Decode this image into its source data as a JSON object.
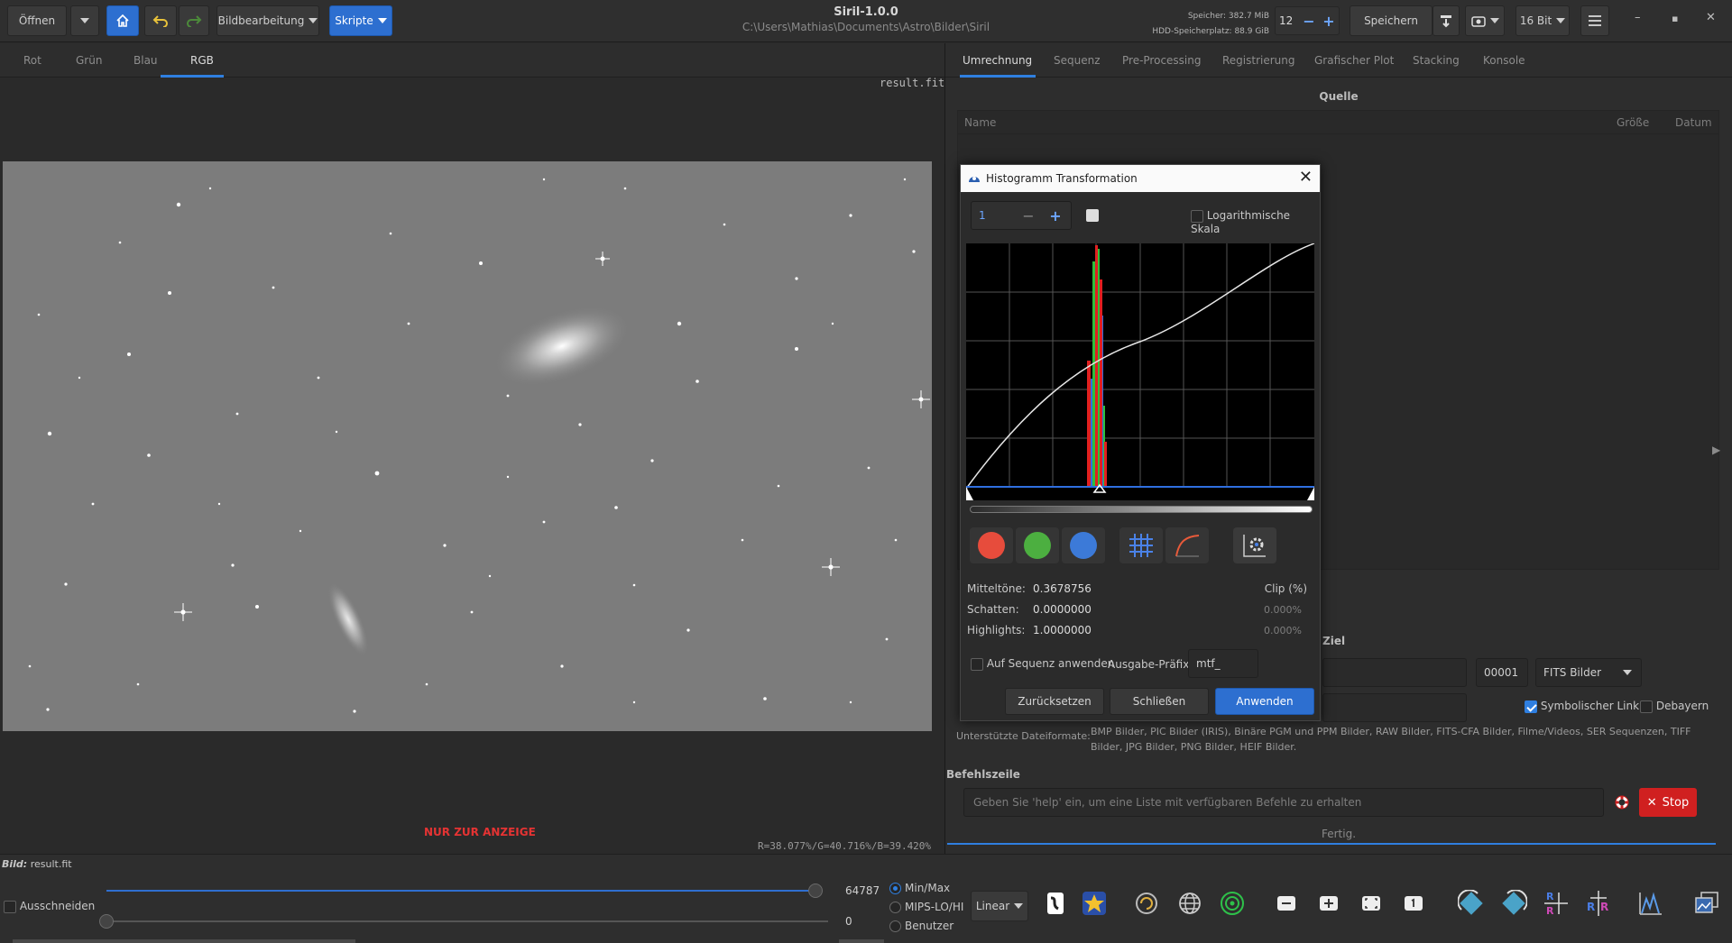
{
  "header": {
    "open": "Öffnen",
    "image_processing": "Bildbearbeitung",
    "scripts": "Skripte",
    "title": "Siril-1.0.0",
    "path": "C:\\Users\\Mathias\\Documents\\Astro\\Bilder\\Siril",
    "memory": "Speicher: 382.7 MiB",
    "disk": "HDD-Speicherplatz: 88.9 GiB",
    "threads": "12",
    "save": "Speichern",
    "bitdepth": "16 Bit"
  },
  "left_tabs": [
    "Rot",
    "Grün",
    "Blau",
    "RGB"
  ],
  "image": {
    "name": "result.fit",
    "display_only": "NUR ZUR ANZEIGE",
    "rgb_readout": "R=38.077%/G=40.716%/B=39.420%"
  },
  "right_tabs": [
    "Umrechnung",
    "Sequenz",
    "Pre-Processing",
    "Registrierung",
    "Grafischer Plot",
    "Stacking",
    "Konsole"
  ],
  "conversion": {
    "source_title": "Quelle",
    "columns": [
      "Name",
      "Größe",
      "Datum"
    ],
    "target_title": "Ziel",
    "start_index": "00001",
    "output_type": "FITS Bilder",
    "symlink": "Symbolischer Link",
    "debayer": "Debayern",
    "formats_label": "Unterstützte Dateiformate:",
    "formats_text": "BMP Bilder, PIC Bilder (IRIS), Binäre PGM und PPM Bilder, RAW Bilder, FITS-CFA Bilder, Filme/Videos, SER Sequenzen, TIFF Bilder, JPG Bilder, PNG Bilder, HEIF Bilder."
  },
  "commandline": {
    "title": "Befehlszeile",
    "placeholder": "Geben Sie 'help' ein, um eine Liste mit verfügbaren Befehle zu erhalten",
    "stop": "Stop",
    "status": "Fertig."
  },
  "bottom": {
    "image_label": "Bild:",
    "image_value": "result.fit",
    "crop": "Ausschneiden",
    "high_value": "64787",
    "low_value": "0",
    "modes": [
      "Min/Max",
      "MIPS-LO/HI",
      "Benutzer"
    ],
    "scale": "Linear"
  },
  "dialog": {
    "title": "Histogramm Transformation",
    "zoom": "1",
    "log_scale": "Logarithmische Skala",
    "midtones_label": "Mitteltöne:",
    "midtones": "0.3678756",
    "shadows_label": "Schatten:",
    "shadows": "0.0000000",
    "highlights_label": "Highlights:",
    "highlights": "1.0000000",
    "clip_label": "Clip (%)",
    "clip_shadows": "0.000%",
    "clip_highlights": "0.000%",
    "apply_sequence": "Auf Sequenz anwenden",
    "prefix_label": "Ausgabe-Präfix:",
    "prefix": "mtf_",
    "reset": "Zurücksetzen",
    "close": "Schließen",
    "apply": "Anwenden"
  },
  "colors": {
    "accent": "#2f7fe0",
    "stop": "#d02020",
    "display_only": "#e53333"
  }
}
